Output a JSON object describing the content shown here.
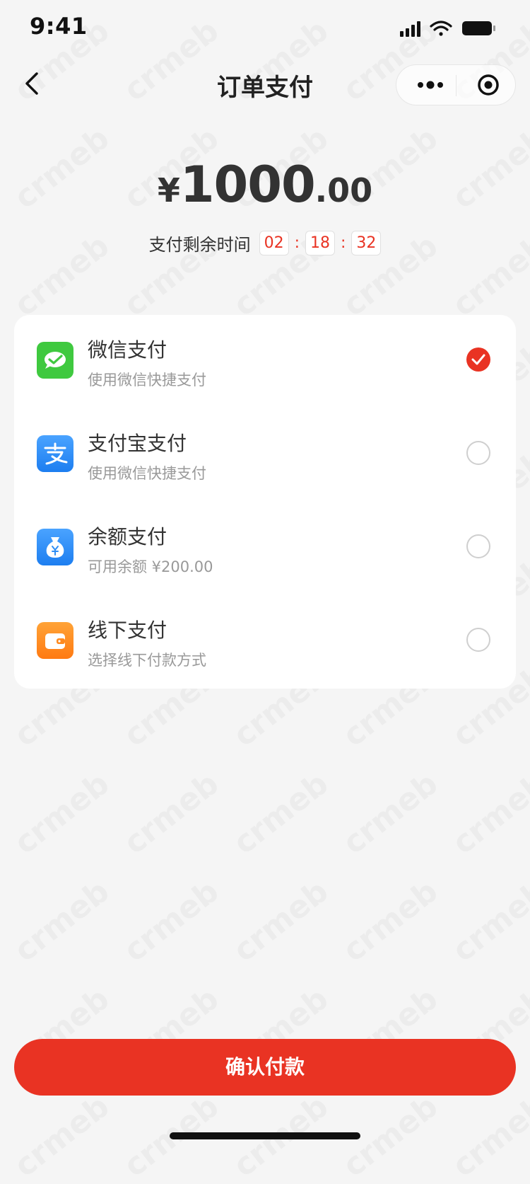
{
  "status_bar": {
    "time": "9:41"
  },
  "nav": {
    "title": "订单支付"
  },
  "amount": {
    "currency": "¥",
    "integer": "1000",
    "decimal": ".00"
  },
  "timer": {
    "label": "支付剩余时间",
    "hours": "02",
    "minutes": "18",
    "seconds": "32",
    "separator": ":"
  },
  "payment_methods": [
    {
      "name": "微信支付",
      "desc": "使用微信快捷支付",
      "selected": true,
      "icon": "wechat-pay-icon",
      "color": "#3fc93f"
    },
    {
      "name": "支付宝支付",
      "desc": "使用微信快捷支付",
      "selected": false,
      "icon": "alipay-icon",
      "color": "#2e8ef5"
    },
    {
      "name": "余额支付",
      "desc": "可用余额 ¥200.00",
      "selected": false,
      "icon": "balance-icon",
      "color": "#2e8ef5"
    },
    {
      "name": "线下支付",
      "desc": "选择线下付款方式",
      "selected": false,
      "icon": "wallet-icon",
      "color": "#ff8a1e"
    }
  ],
  "confirm_button": {
    "label": "确认付款"
  },
  "watermark": "crmeb",
  "colors": {
    "accent": "#e93323",
    "background": "#f5f5f5"
  }
}
